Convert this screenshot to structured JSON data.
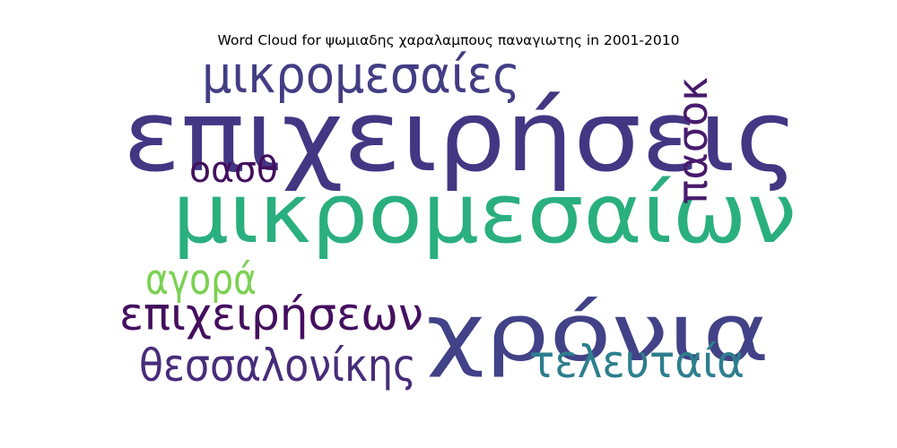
{
  "chart_data": {
    "type": "wordcloud",
    "title": "Word Cloud for ψωμιαδης χαραλαμπους παναγιωτης in 2001-2010",
    "words": [
      {
        "text": "επιχειρήσεις",
        "weight": 1.0,
        "color": "#433683",
        "orientation": "horizontal"
      },
      {
        "text": "μικρομεσαίων",
        "weight": 0.84,
        "color": "#2aaf7f",
        "orientation": "horizontal"
      },
      {
        "text": "χρόνια",
        "weight": 0.8,
        "color": "#414287",
        "orientation": "horizontal"
      },
      {
        "text": "μικρομεσαίες",
        "weight": 0.52,
        "color": "#433d84",
        "orientation": "horizontal"
      },
      {
        "text": "επιχειρήσεων",
        "weight": 0.45,
        "color": "#440f5f",
        "orientation": "horizontal"
      },
      {
        "text": "θεσσαλονίκης",
        "weight": 0.45,
        "color": "#472c7a",
        "orientation": "horizontal"
      },
      {
        "text": "τελευταία",
        "weight": 0.45,
        "color": "#2d7e8e",
        "orientation": "horizontal"
      },
      {
        "text": "αγορά",
        "weight": 0.43,
        "color": "#7ad151",
        "orientation": "horizontal"
      },
      {
        "text": "πασοκ",
        "weight": 0.42,
        "color": "#481a6c",
        "orientation": "vertical"
      },
      {
        "text": "οασθ",
        "weight": 0.36,
        "color": "#440e5d",
        "orientation": "horizontal"
      }
    ]
  }
}
